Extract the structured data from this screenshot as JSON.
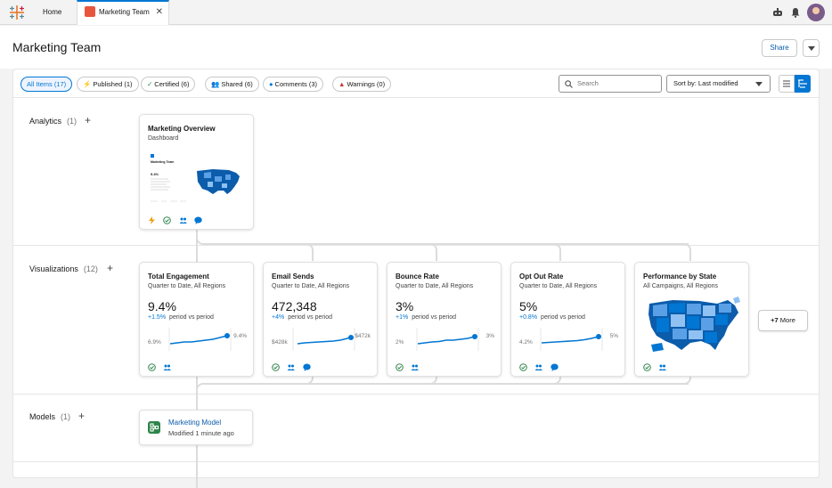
{
  "tabs": {
    "home_label": "Home",
    "active_label": "Marketing Team",
    "close_glyph": "✕"
  },
  "header": {
    "title": "Marketing Team",
    "share_label": "Share"
  },
  "filters": [
    {
      "label": "All Items (17)",
      "icon": ""
    },
    {
      "label": "Published (1)",
      "icon": "bolt-icon"
    },
    {
      "label": "Certified (6)",
      "icon": "check-circle-icon"
    },
    {
      "label": "Shared (6)",
      "icon": "people-icon"
    },
    {
      "label": "Comments (3)",
      "icon": "comment-icon"
    },
    {
      "label": "Warnings (0)",
      "icon": "warning-icon"
    }
  ],
  "search": {
    "placeholder": "Search"
  },
  "sort": {
    "label": "Sort by: Last modified"
  },
  "sections": {
    "analytics": {
      "label": "Analytics",
      "count": "(1)"
    },
    "visualizations": {
      "label": "Visualizations",
      "count": "(12)"
    },
    "models": {
      "label": "Models",
      "count": "(1)"
    }
  },
  "dashboard_card": {
    "title": "Marketing Overview",
    "subtitle": "Dashboard",
    "thumb_title": "Marketing Team",
    "thumb_value": "9.4%"
  },
  "kpi_cards": [
    {
      "title": "Total Engagement",
      "subtitle": "Quarter to Date, All Regions",
      "value": "9.4%",
      "delta": "+1.5%",
      "delta_label": "period vs period",
      "min": "6.9%",
      "max": "9.4%"
    },
    {
      "title": "Email Sends",
      "subtitle": "Quarter to Date, All Regions",
      "value": "472,348",
      "delta": "+4%",
      "delta_label": "period vs period",
      "min": "$428k",
      "max": "$472k"
    },
    {
      "title": "Bounce Rate",
      "subtitle": "Quarter to Date, All Regions",
      "value": "3%",
      "delta": "+1%",
      "delta_label": "period vs period",
      "min": "2%",
      "max": "3%"
    },
    {
      "title": "Opt Out Rate",
      "subtitle": "Quarter to Date, All Regions",
      "value": "5%",
      "delta": "+0.8%",
      "delta_label": "period vs period",
      "min": "4.2%",
      "max": "5%"
    }
  ],
  "map_card": {
    "title": "Performance by State",
    "subtitle": "All Campaigns, All Regions"
  },
  "more_card": {
    "count": "+7",
    "label": "More"
  },
  "model_card": {
    "name": "Marketing Model",
    "subtitle": "Modified 1 minute ago"
  },
  "colors": {
    "accent": "#0176d3",
    "map_dark": "#0b5cab",
    "map_light": "#8fc1f2",
    "published": "#e8a317",
    "certified": "#2e844a",
    "warning": "#c23934"
  }
}
